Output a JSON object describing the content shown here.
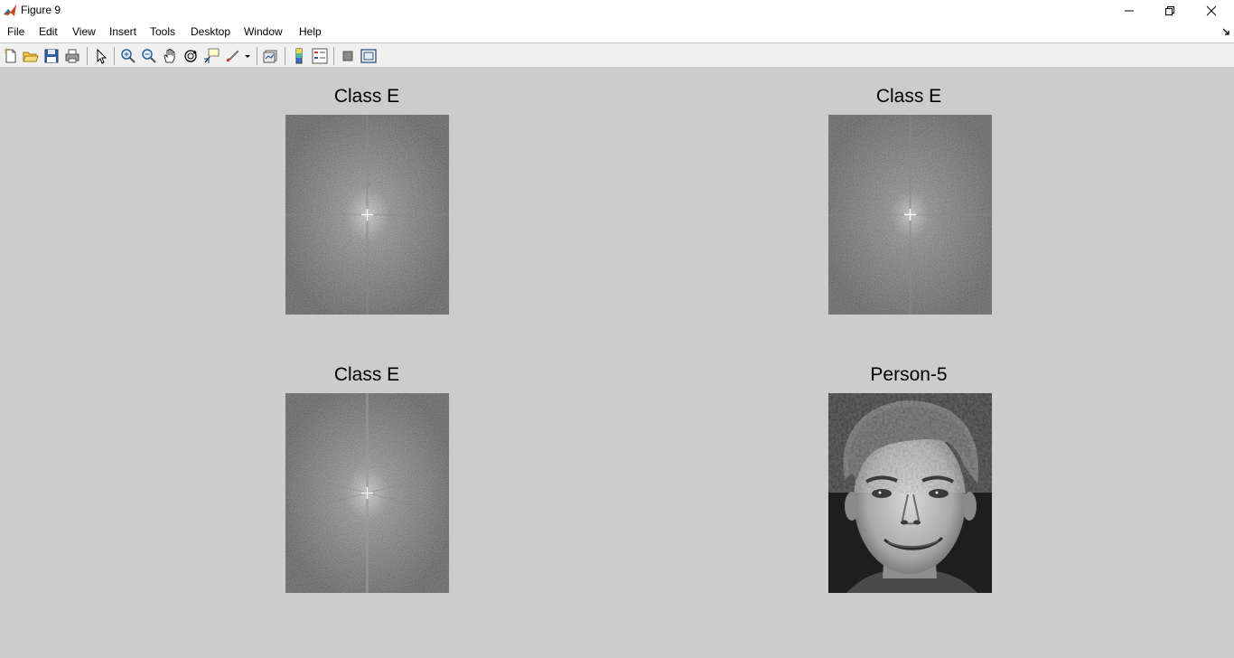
{
  "window": {
    "title": "Figure 9"
  },
  "menu": [
    "File",
    "Edit",
    "View",
    "Insert",
    "Tools",
    "Desktop",
    "Window",
    "Help"
  ],
  "toolbar": {
    "icons": [
      "new-figure-icon",
      "open-file-icon",
      "save-icon",
      "print-icon",
      "edit-plot-icon",
      "zoom-in-icon",
      "zoom-out-icon",
      "pan-icon",
      "rotate-3d-icon",
      "data-cursor-icon",
      "brush-icon",
      "link-plot-icon",
      "insert-colorbar-icon",
      "insert-legend-icon",
      "hide-plot-tools-icon",
      "show-plot-tools-icon"
    ]
  },
  "plots": [
    {
      "title": "Class E",
      "kind": "spectrum"
    },
    {
      "title": "Class E",
      "kind": "spectrum"
    },
    {
      "title": "Class E",
      "kind": "spectrum"
    },
    {
      "title": "Person-5",
      "kind": "face"
    }
  ],
  "colors": {
    "figure_bg": "#cccccc",
    "toolbar_bg": "#f0f0f0",
    "menubar_bg": "#ffffff"
  }
}
